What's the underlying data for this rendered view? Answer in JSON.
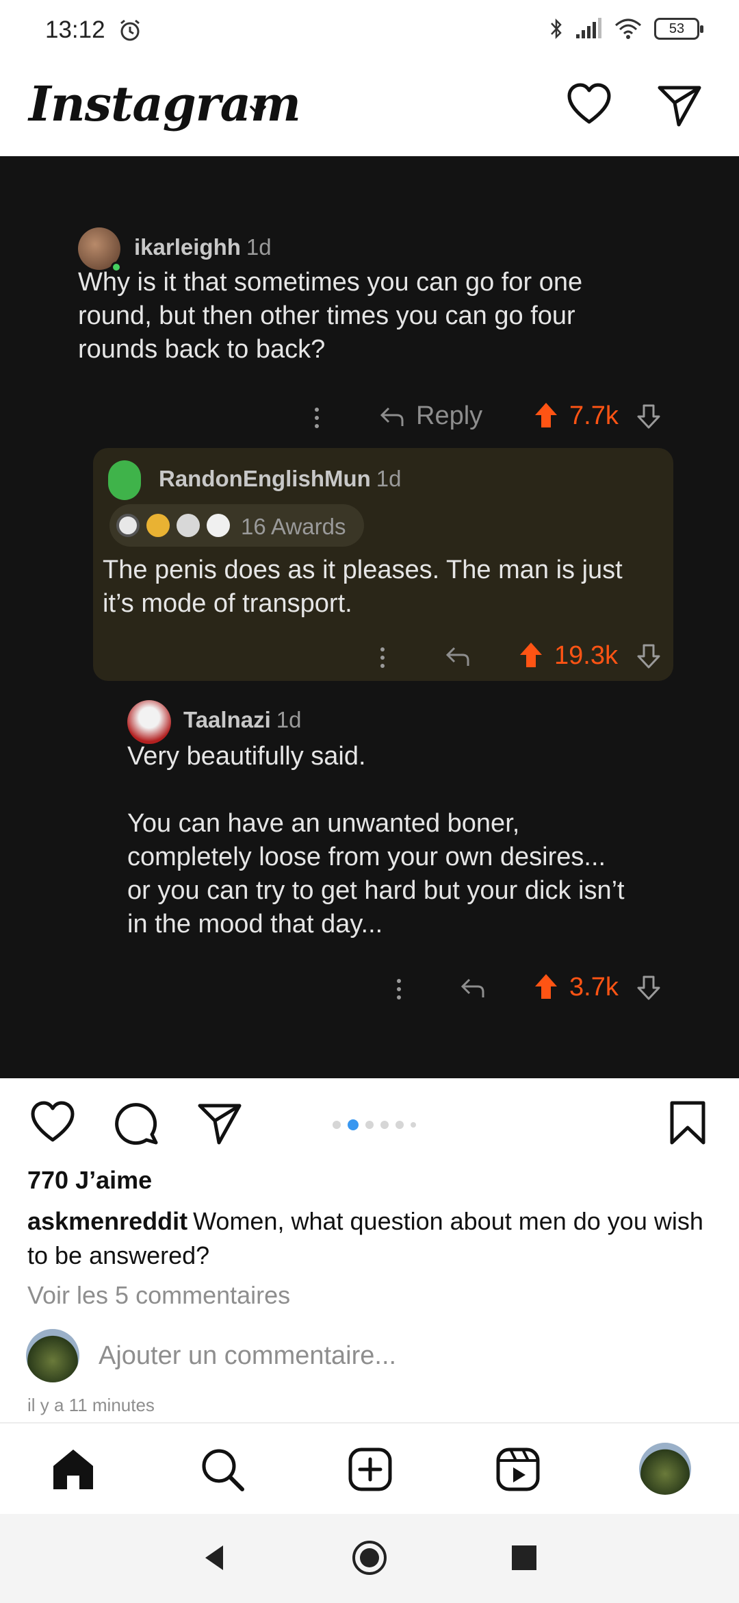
{
  "status_bar": {
    "time": "13:12",
    "battery": "53",
    "icons": [
      "alarm-icon",
      "bluetooth-icon",
      "signal-icon",
      "wifi-icon",
      "battery-icon"
    ]
  },
  "header": {
    "logo_text": "Instagram",
    "icons": [
      "chevron-down-icon",
      "heart-icon",
      "send-icon"
    ]
  },
  "post_image": {
    "comments": [
      {
        "username": "ikarleighh",
        "age": "1d",
        "body": "Why is it that sometimes you can go for one\nround, but then other times you can go four\nrounds back to back?",
        "reply_label": "Reply",
        "score": "7.7k"
      },
      {
        "username": "RandonEnglishMun",
        "age": "1d",
        "awards": "16 Awards",
        "body": "The penis does as it pleases. The man is just\nit’s mode of transport.",
        "score": "19.3k"
      },
      {
        "username": "Taalnazi",
        "age": "1d",
        "body": "Very beautifully said.\n\nYou can have an unwanted boner,\ncompletely loose from your own desires...\nor you can try to get hard but your dick isn’t\nin the mood that day...",
        "score": "3.7k"
      }
    ],
    "colors": {
      "background": "#131313",
      "upvote": "#ff5414",
      "highlight": "#2a2618"
    }
  },
  "post": {
    "likes": "770 J’aime",
    "caption_user": "askmenreddit",
    "caption_text": "Women, what question about men do you wish to be answered?",
    "view_comments": "Voir les 5 commentaires",
    "add_comment_placeholder": "Ajouter un commentaire...",
    "timestamp": "il y a 11 minutes",
    "carousel": {
      "count": 6,
      "active_index": 1,
      "active_color": "#3897f0"
    }
  },
  "bottom_nav": {
    "items": [
      "home-icon",
      "search-icon",
      "create-icon",
      "reels-icon",
      "profile-avatar"
    ]
  },
  "system_nav": {
    "items": [
      "back-icon",
      "home-circle-icon",
      "recents-icon"
    ]
  }
}
